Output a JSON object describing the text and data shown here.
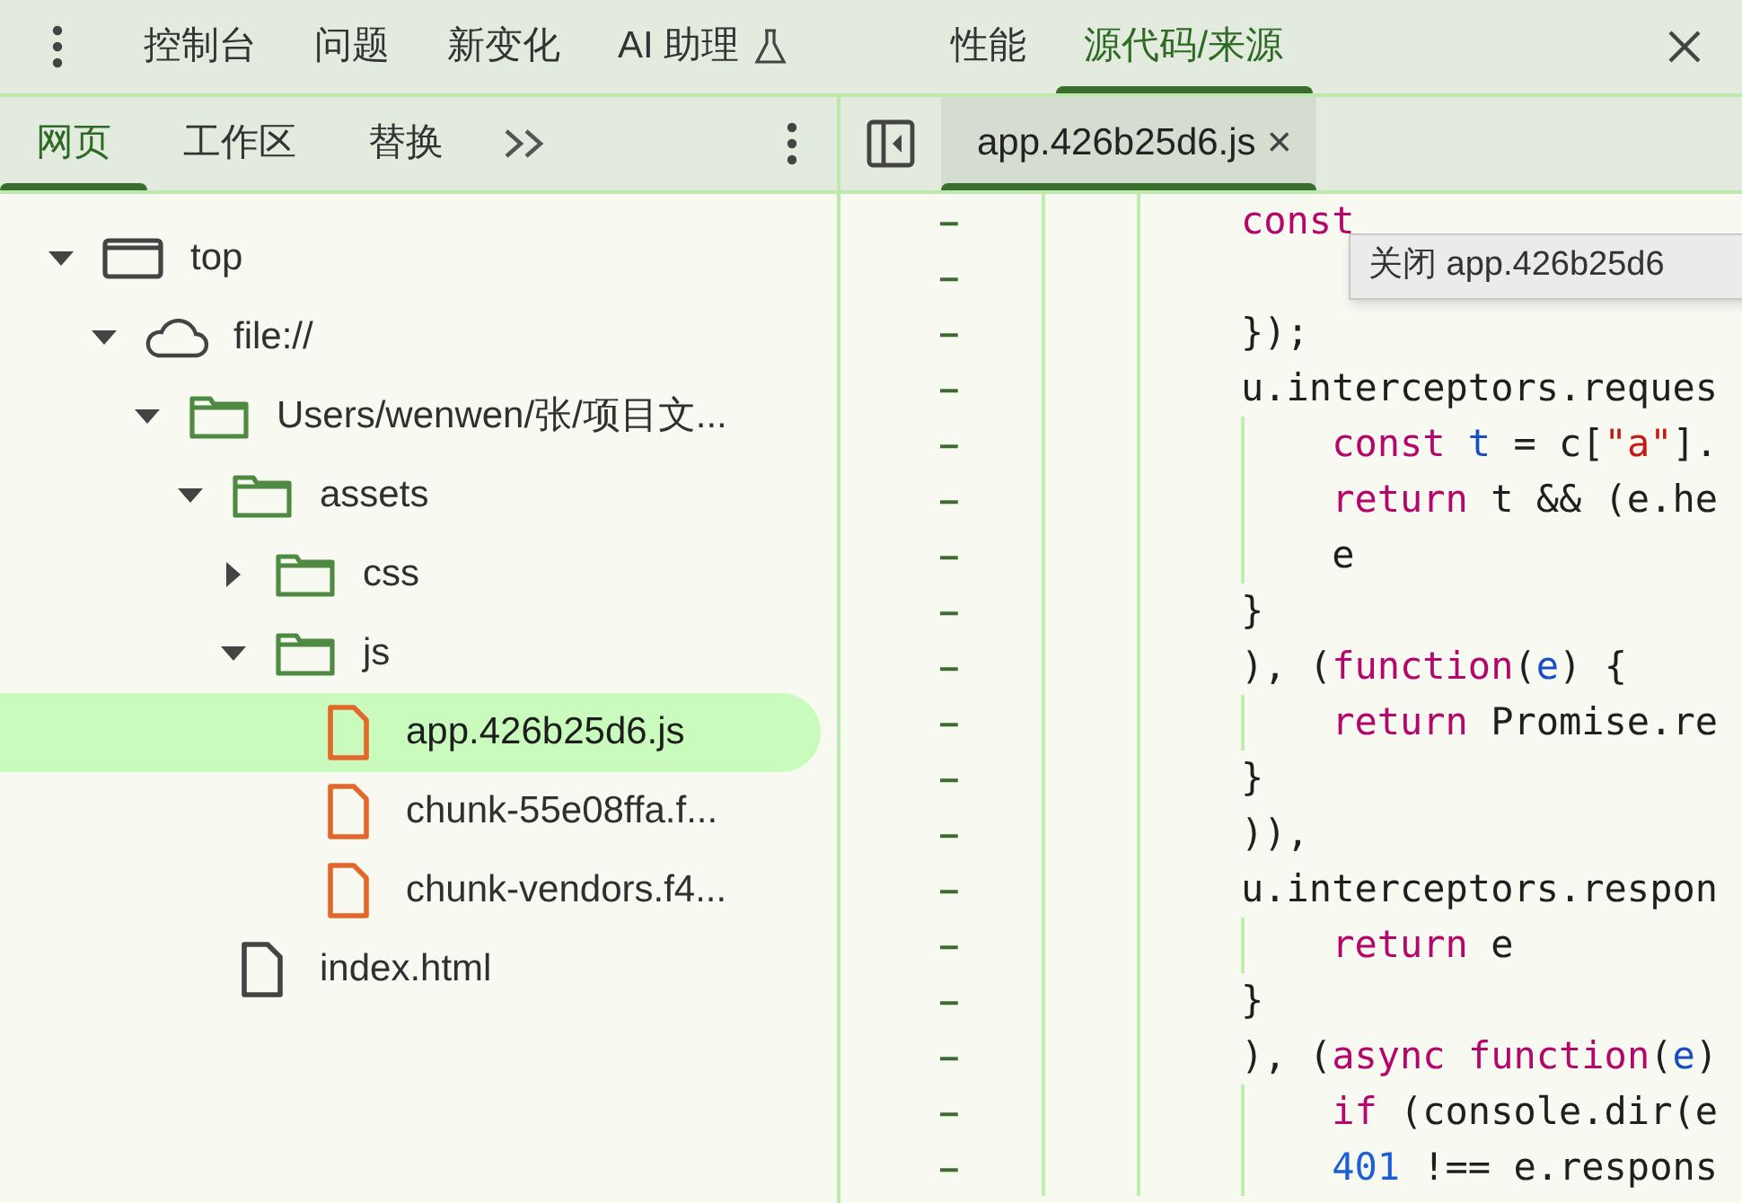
{
  "toolbar": {
    "tabs": [
      {
        "label": "控制台",
        "selected": false
      },
      {
        "label": "问题",
        "selected": false
      },
      {
        "label": "新变化",
        "selected": false
      },
      {
        "label": "AI 助理",
        "selected": false,
        "kind": "experimental"
      },
      {
        "label": "性能",
        "selected": false
      },
      {
        "label": "源代码/来源",
        "selected": true
      }
    ]
  },
  "navigator": {
    "tabs": [
      {
        "label": "网页",
        "selected": true
      },
      {
        "label": "工作区",
        "selected": false
      },
      {
        "label": "替换",
        "selected": false
      }
    ],
    "tree": [
      {
        "label": "top",
        "kind": "frame",
        "expanded": true,
        "selected": false,
        "children": [
          {
            "label": "file://",
            "kind": "domain",
            "expanded": true,
            "selected": false,
            "children": [
              {
                "label": "Users/wenwen/张/项目文...",
                "kind": "folder",
                "expanded": true,
                "selected": false,
                "children": [
                  {
                    "label": "assets",
                    "kind": "folder",
                    "expanded": true,
                    "selected": false,
                    "children": [
                      {
                        "label": "css",
                        "kind": "folder",
                        "expanded": false,
                        "selected": false
                      },
                      {
                        "label": "js",
                        "kind": "folder",
                        "expanded": true,
                        "selected": false,
                        "children": [
                          {
                            "label": "app.426b25d6.js",
                            "kind": "script",
                            "selected": true
                          },
                          {
                            "label": "chunk-55e08ffa.f...",
                            "kind": "script",
                            "selected": false
                          },
                          {
                            "label": "chunk-vendors.f4...",
                            "kind": "script",
                            "selected": false
                          }
                        ]
                      }
                    ]
                  },
                  {
                    "label": "index.html",
                    "kind": "document",
                    "selected": false
                  }
                ]
              }
            ]
          }
        ]
      }
    ]
  },
  "editor": {
    "tabs": [
      {
        "label": "app.426b25d6.js",
        "selected": true,
        "close": "×"
      }
    ],
    "tooltip": "关闭 app.426b25d6",
    "lines": [
      {
        "marker": "–",
        "tokens": [
          {
            "text": "const",
            "kind": "keyword"
          }
        ]
      },
      {
        "marker": "–"
      },
      {
        "marker": "–",
        "tokens": [
          {
            "text": "});",
            "kind": "plain"
          }
        ]
      },
      {
        "marker": "–",
        "tokens": [
          {
            "text": "u.interceptors.reques",
            "kind": "plain"
          }
        ]
      },
      {
        "marker": "–",
        "tokens": [
          {
            "text": "    const",
            "kind": "keyword"
          },
          {
            "text": " t",
            "kind": "variable"
          },
          {
            "text": " = c[",
            "kind": "plain"
          },
          {
            "text": "\"a\"",
            "kind": "string"
          },
          {
            "text": "].",
            "kind": "plain"
          }
        ]
      },
      {
        "marker": "–",
        "tokens": [
          {
            "text": "    return",
            "kind": "keyword"
          },
          {
            "text": " t && (e.he",
            "kind": "plain"
          }
        ]
      },
      {
        "marker": "–",
        "tokens": [
          {
            "text": "    e",
            "kind": "plain"
          }
        ]
      },
      {
        "marker": "–",
        "tokens": [
          {
            "text": "}",
            "kind": "plain"
          }
        ]
      },
      {
        "marker": "–",
        "tokens": [
          {
            "text": "), (",
            "kind": "plain"
          },
          {
            "text": "function",
            "kind": "keyword"
          },
          {
            "text": "(",
            "kind": "plain"
          },
          {
            "text": "e",
            "kind": "variable"
          },
          {
            "text": ") {",
            "kind": "plain"
          }
        ]
      },
      {
        "marker": "–",
        "tokens": [
          {
            "text": "    return",
            "kind": "keyword"
          },
          {
            "text": " Promise.re",
            "kind": "plain"
          }
        ]
      },
      {
        "marker": "–",
        "tokens": [
          {
            "text": "}",
            "kind": "plain"
          }
        ]
      },
      {
        "marker": "–",
        "tokens": [
          {
            "text": ")),",
            "kind": "plain"
          }
        ]
      },
      {
        "marker": "–",
        "tokens": [
          {
            "text": "u.interceptors.respon",
            "kind": "plain"
          }
        ]
      },
      {
        "marker": "–",
        "tokens": [
          {
            "text": "    return",
            "kind": "keyword"
          },
          {
            "text": " e",
            "kind": "plain"
          }
        ]
      },
      {
        "marker": "–",
        "tokens": [
          {
            "text": "}",
            "kind": "plain"
          }
        ]
      },
      {
        "marker": "–",
        "tokens": [
          {
            "text": "), (",
            "kind": "plain"
          },
          {
            "text": "async",
            "kind": "keyword"
          },
          {
            "text": " function",
            "kind": "keyword"
          },
          {
            "text": "(",
            "kind": "plain"
          },
          {
            "text": "e",
            "kind": "variable"
          },
          {
            "text": ")",
            "kind": "plain"
          }
        ]
      },
      {
        "marker": "–",
        "tokens": [
          {
            "text": "    if",
            "kind": "keyword"
          },
          {
            "text": " (console.dir(e",
            "kind": "plain"
          }
        ]
      },
      {
        "marker": "–",
        "tokens": [
          {
            "text": "    401",
            "kind": "number"
          },
          {
            "text": " !== e.respons",
            "kind": "plain"
          }
        ]
      }
    ]
  }
}
